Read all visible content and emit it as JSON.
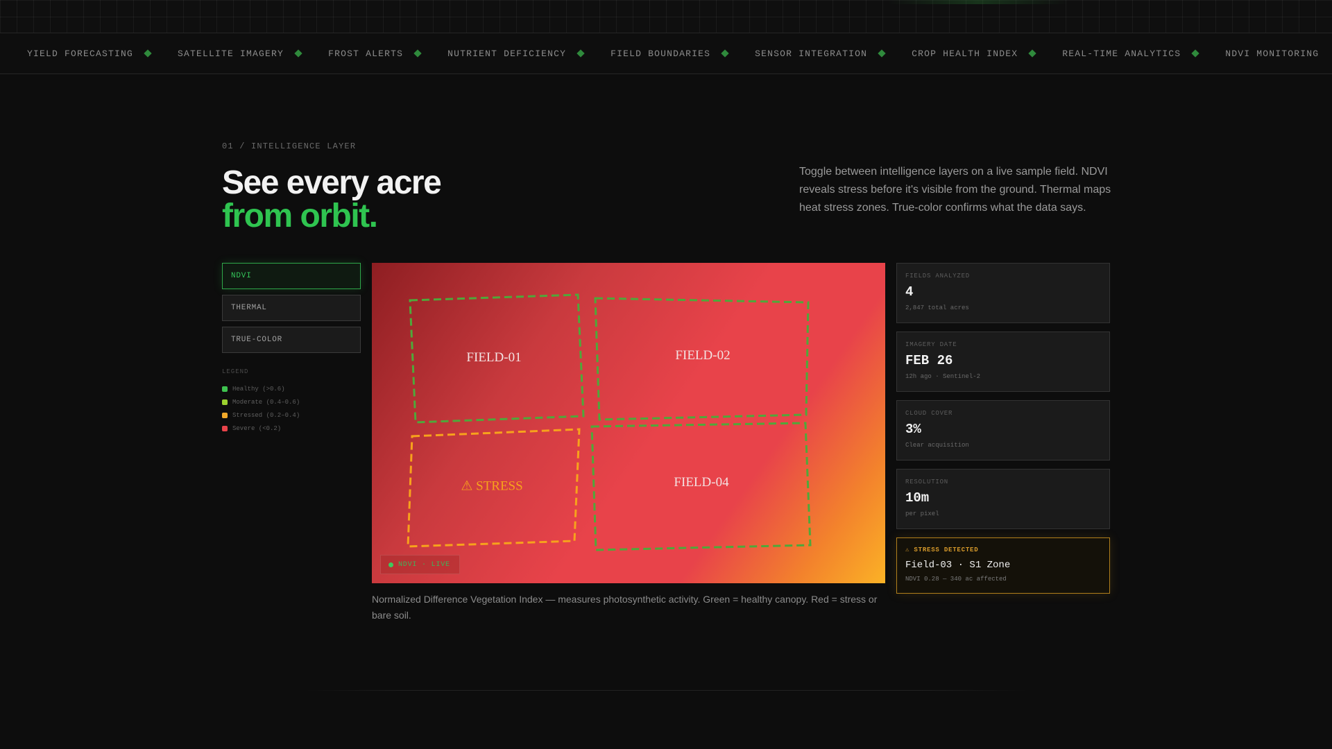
{
  "ticker": {
    "items": [
      "YIELD FORECASTING",
      "SATELLITE IMAGERY",
      "FROST ALERTS",
      "NUTRIENT DEFICIENCY",
      "FIELD BOUNDARIES",
      "SENSOR INTEGRATION",
      "CROP HEALTH INDEX",
      "REAL-TIME ANALYTICS",
      "NDVI MONITORING"
    ]
  },
  "section": {
    "eyebrow": "01 / INTELLIGENCE LAYER",
    "title_line1": "See every acre",
    "title_line2": "from orbit.",
    "description": "Toggle between intelligence layers on a live sample field. NDVI reveals stress before it's visible from the ground. Thermal maps heat stress zones. True-color confirms what the data says."
  },
  "layers": {
    "buttons": [
      "NDVI",
      "THERMAL",
      "TRUE-COLOR"
    ],
    "active": "NDVI"
  },
  "legend": {
    "title": "LEGEND",
    "items": [
      {
        "label": "Healthy (>0.6)",
        "color": "#3ec24f"
      },
      {
        "label": "Moderate (0.4–0.6)",
        "color": "#9bd12e"
      },
      {
        "label": "Stressed (0.2–0.4)",
        "color": "#f0a92a"
      },
      {
        "label": "Severe (<0.2)",
        "color": "#e8434a"
      }
    ]
  },
  "map": {
    "fields": [
      {
        "label": "FIELD-01",
        "status": "healthy"
      },
      {
        "label": "FIELD-02",
        "status": "healthy"
      },
      {
        "label": "⚠ STRESS",
        "status": "stressed"
      },
      {
        "label": "FIELD-04",
        "status": "healthy"
      }
    ],
    "badge": "NDVI · LIVE",
    "caption": "Normalized Difference Vegetation Index — measures photosynthetic activity. Green = healthy canopy. Red = stress or bare soil.",
    "colors": {
      "healthy_outline": "#4fa83a",
      "stress_outline": "#f7a21c"
    }
  },
  "stats": [
    {
      "label": "FIELDS ANALYZED",
      "value": "4",
      "sub": "2,847 total acres"
    },
    {
      "label": "IMAGERY DATE",
      "value": "FEB 26",
      "sub": "12h ago · Sentinel-2"
    },
    {
      "label": "CLOUD COVER",
      "value": "3%",
      "sub": "Clear acquisition"
    },
    {
      "label": "RESOLUTION",
      "value": "10m",
      "sub": "per pixel"
    }
  ],
  "alert": {
    "label": "⚠ STRESS DETECTED",
    "title": "Field-03 · S1 Zone",
    "sub": "NDVI 0.28 — 340 ac affected"
  },
  "theme": {
    "accent": "#2fc450",
    "background": "#0d0d0d",
    "alert": "#b2801c"
  }
}
